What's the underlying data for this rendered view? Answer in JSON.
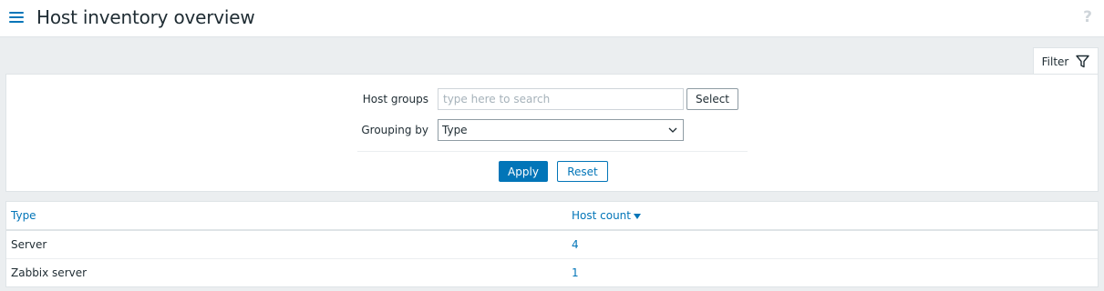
{
  "header": {
    "title": "Host inventory overview",
    "help_label": "?"
  },
  "filter": {
    "tab_label": "Filter",
    "host_groups_label": "Host groups",
    "host_groups_placeholder": "type here to search",
    "select_label": "Select",
    "grouping_label": "Grouping by",
    "grouping_value": "Type",
    "apply_label": "Apply",
    "reset_label": "Reset"
  },
  "table": {
    "columns": [
      {
        "label": "Type"
      },
      {
        "label": "Host count",
        "sorted": "desc"
      }
    ],
    "rows": [
      {
        "type": "Server",
        "count": "4"
      },
      {
        "type": "Zabbix server",
        "count": "1"
      }
    ]
  },
  "colors": {
    "accent": "#0275b8",
    "background": "#ebeef0",
    "text": "#1f2c33"
  },
  "icons": [
    "menu-icon",
    "help-icon",
    "filter-icon",
    "chevron-down-icon",
    "sort-descending-icon"
  ]
}
